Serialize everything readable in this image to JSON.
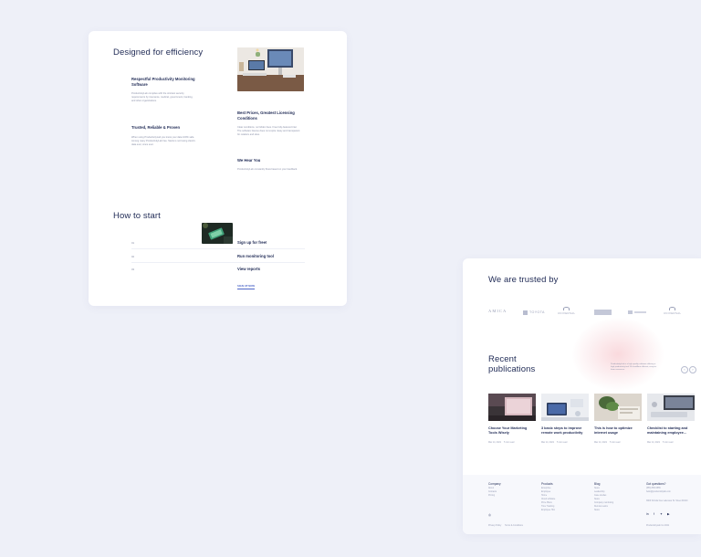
{
  "efficiency": {
    "title": "Designed for efficiency",
    "features": [
      {
        "title": "Respectful Productivity Monitoring Software",
        "desc": "ProductivityLab complies with the strictest security requirements by insurance, medical, government, banking, and other organizations."
      },
      {
        "title": "Best Prices, Greatest Licensing Conditions",
        "desc": "Clear conditions, no hidden fees. Free fully-featured trial. The software license does not expire. Easy and transparent for retailers and sites."
      },
      {
        "title": "Trusted, Reliable & Proven",
        "desc": "When using ProductivityLab you know your data 100% safe. Among many ProductivityLab has. Starts is not losing client's data ever, since ever."
      },
      {
        "title": "We Hear You",
        "desc": "ProductivityLab constantly flows based on your feedback."
      }
    ]
  },
  "how_to_start": {
    "title": "How to start",
    "steps": [
      {
        "num": "01",
        "label": "Sign up for free!"
      },
      {
        "num": "02",
        "label": "Run monitoring tool"
      },
      {
        "num": "03",
        "label": "View reports"
      }
    ],
    "cta": "SIGN UP NOW"
  },
  "trusted": {
    "title": "We are trusted by",
    "logos": [
      "AMICA",
      "TOYOTA",
      "UNIVERSAL",
      "",
      "",
      "UNIVERSAL"
    ]
  },
  "publications": {
    "title_line1": "Recent",
    "title_line2": "publications",
    "blurb": "ProductivityLab is a high quality software offering a high productivity tool 14 cloudflare efficient, easy-to-learn resources.",
    "items": [
      {
        "title": "Choose Your Marketing Tools Wisely",
        "date": "Mar 14, 2021",
        "read": "5 min read"
      },
      {
        "title": "3 basic steps to improve remote work productivity",
        "date": "Mar 14, 2021",
        "read": "5 min read"
      },
      {
        "title": "This is how to optimize internet usage",
        "date": "Mar 14, 2021",
        "read": "5 min read"
      },
      {
        "title": "Checklist to starting and maintaining employee...",
        "date": "Mar 14, 2021",
        "read": "5 min read"
      }
    ]
  },
  "footer": {
    "columns": [
      {
        "head": "Company",
        "links": [
          "About",
          "Contacts",
          "Pricing"
        ]
      },
      {
        "head": "Products",
        "links": [
          "Enterprise",
          "Employee",
          "Home",
          "Cloud software",
          "Price Plans",
          "Time Tracking",
          "Employee Hint"
        ]
      },
      {
        "head": "Blog",
        "links": [
          "News",
          "Leadership",
          "Case studies",
          "News",
          "Company monitoring",
          "Remote teams",
          "News"
        ]
      },
      {
        "head": "Got questions?",
        "links": [
          "(555) 555-5555",
          "hello@productivitylab.com",
          "",
          "3900 Scholar Ave Lakeview St. Street 90210"
        ]
      }
    ],
    "bottom_left": "Privacy Policy",
    "bottom_mid": "Terms & Conditions",
    "copyright": "ProductivityLab Inc 2021"
  },
  "colors": {
    "accent": "#4f68c8",
    "text": "#1f2a55",
    "muted": "#8a90a8",
    "background": "#eef0f8"
  }
}
